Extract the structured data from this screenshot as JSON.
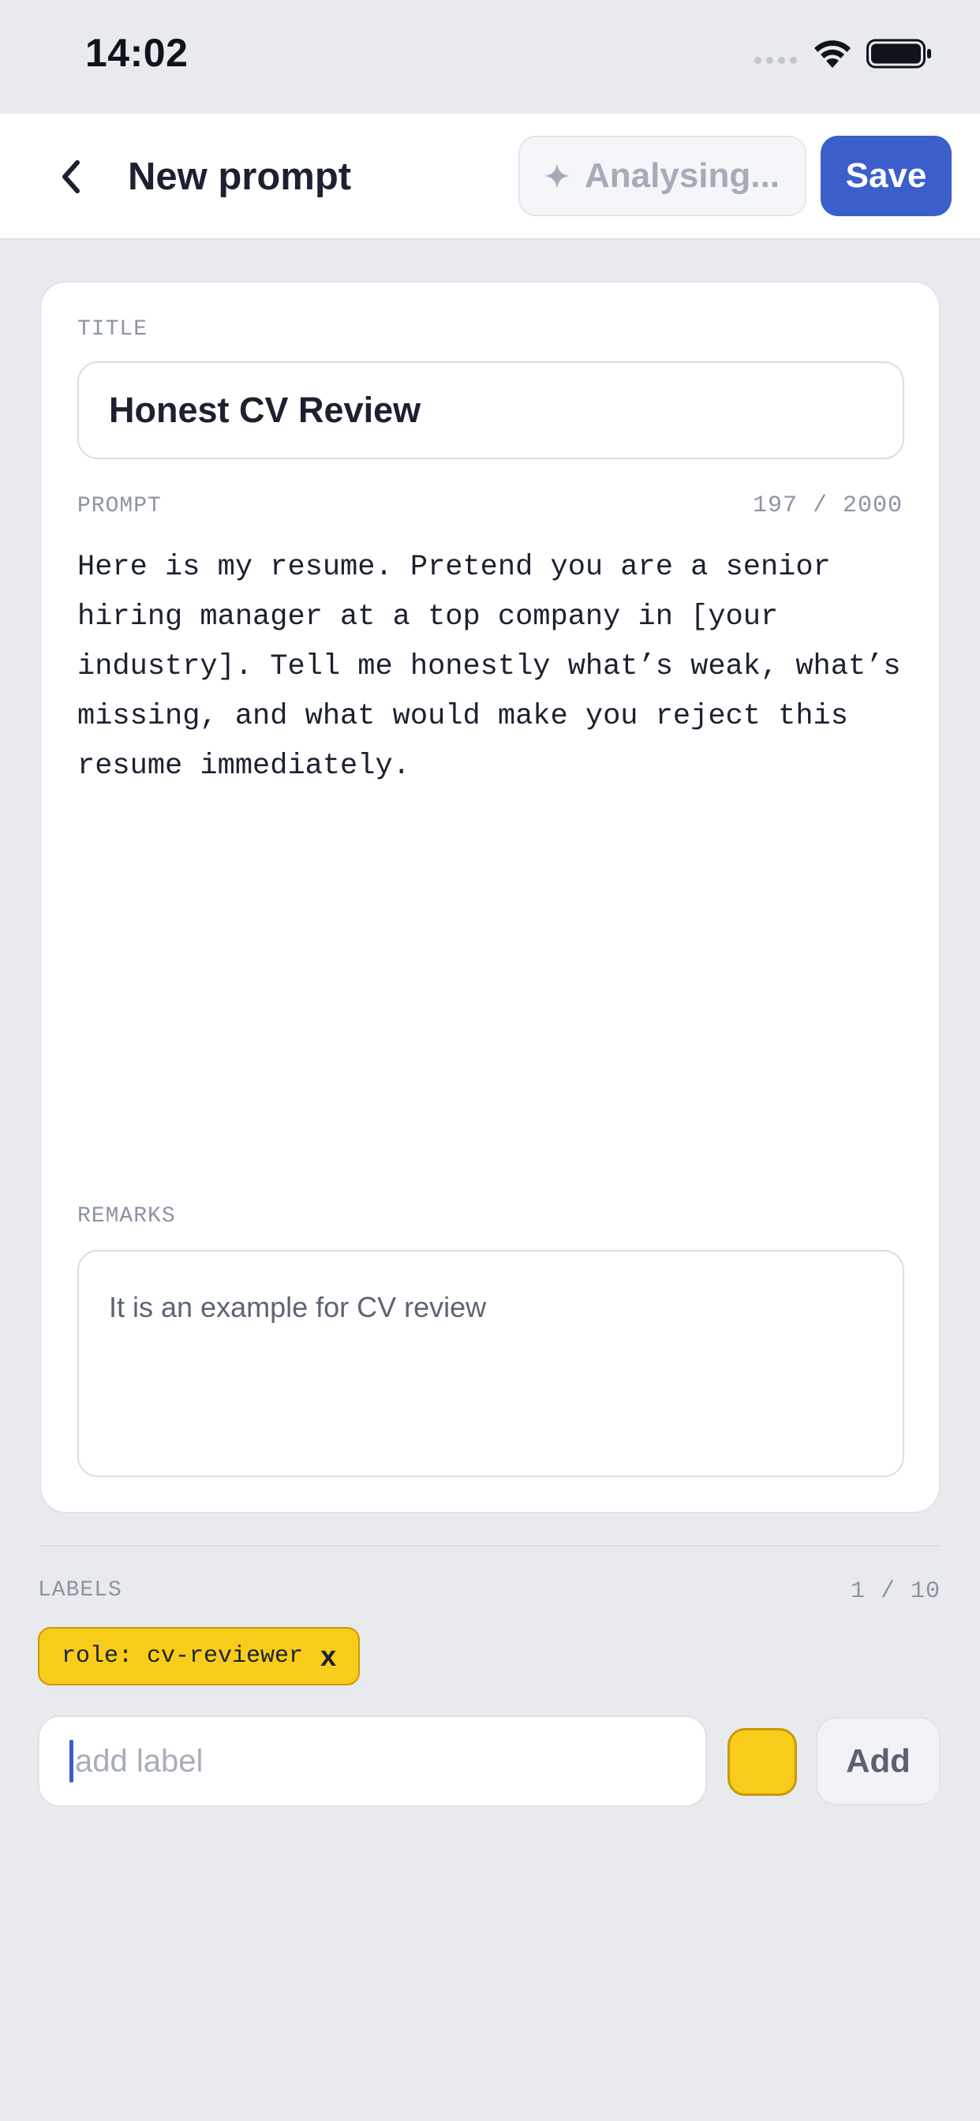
{
  "status_bar": {
    "time": "14:02"
  },
  "header": {
    "title": "New prompt",
    "analyse_label": "Analysing...",
    "save_label": "Save"
  },
  "form": {
    "title_label": "TITLE",
    "title_value": "Honest CV Review",
    "prompt_label": "PROMPT",
    "prompt_counter": "197 / 2000",
    "prompt_value": "Here is my resume. Pretend you are a senior hiring manager at a top company in [your industry]. Tell me honestly what’s weak, what’s missing, and what would make you reject this resume immediately.",
    "remarks_label": "REMARKS",
    "remarks_value": "It is an example for CV review"
  },
  "labels": {
    "heading": "LABELS",
    "counter": "1 / 10",
    "chips": [
      {
        "text": "role: cv-reviewer",
        "remove": "x",
        "color": "#f8cc1b"
      }
    ],
    "input_placeholder": "add label",
    "selected_color": "#f8cc1b",
    "add_label": "Add"
  },
  "colors": {
    "accent": "#3b5ecb",
    "label_yellow": "#f8cc1b",
    "background": "#e9eaee"
  },
  "icons": {
    "back": "chevron-left-icon",
    "analyse": "sparkle-icon"
  }
}
